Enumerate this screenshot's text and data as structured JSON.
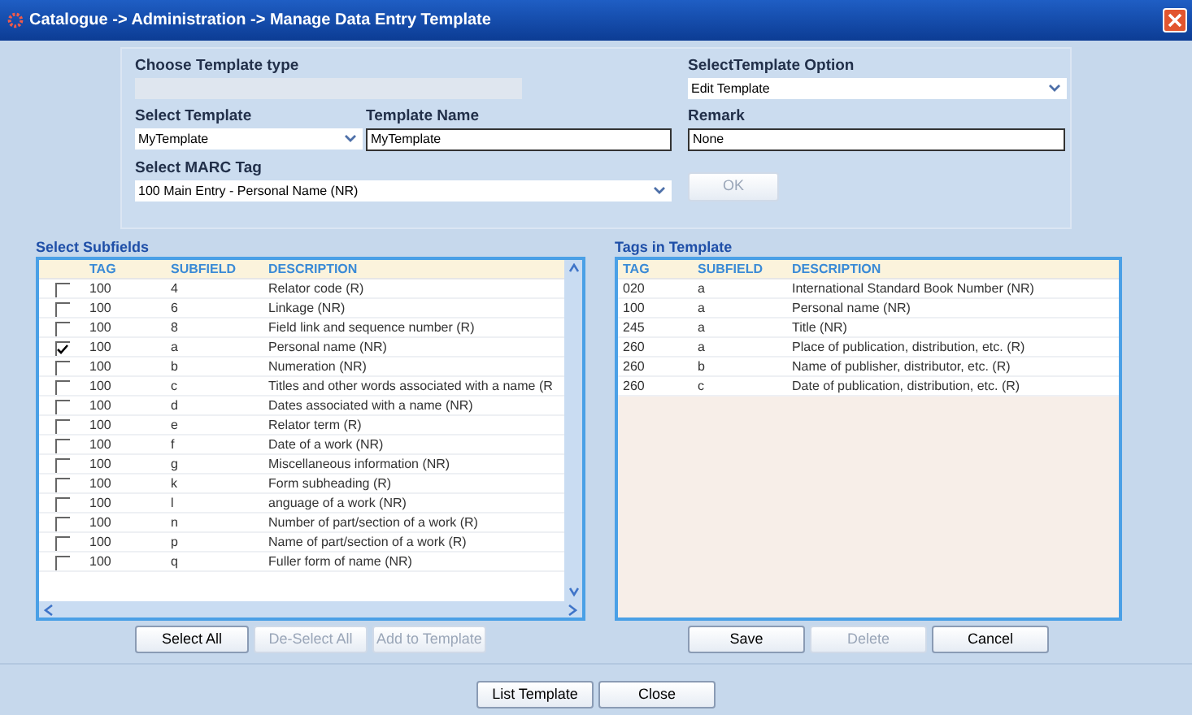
{
  "window": {
    "title": "Catalogue -> Administration -> Manage Data Entry Template"
  },
  "template_type": {
    "label": "Choose Template type",
    "disabled": true
  },
  "template_option": {
    "label": "SelectTemplate Option",
    "value": "Edit Template"
  },
  "select_template": {
    "label": "Select Template",
    "value": "MyTemplate"
  },
  "template_name": {
    "label": "Template Name",
    "value": "MyTemplate"
  },
  "remark": {
    "label": "Remark",
    "value": "None"
  },
  "marc_tag": {
    "label": "Select MARC Tag",
    "value": "100  Main Entry - Personal Name (NR)"
  },
  "ok_button": {
    "label": "OK",
    "disabled": true
  },
  "subfields": {
    "title": "Select Subfields",
    "columns": [
      "TAG",
      "SUBFIELD",
      "DESCRIPTION"
    ],
    "rows": [
      {
        "checked": false,
        "tag": "100",
        "subfield": "4",
        "description": "Relator code (R)"
      },
      {
        "checked": false,
        "tag": "100",
        "subfield": "6",
        "description": "Linkage (NR)"
      },
      {
        "checked": false,
        "tag": "100",
        "subfield": "8",
        "description": "Field link  and sequence number (R)"
      },
      {
        "checked": true,
        "tag": "100",
        "subfield": "a",
        "description": "Personal name (NR)"
      },
      {
        "checked": false,
        "tag": "100",
        "subfield": "b",
        "description": "Numeration (NR)"
      },
      {
        "checked": false,
        "tag": "100",
        "subfield": "c",
        "description": "Titles and other words  associated with a name (R"
      },
      {
        "checked": false,
        "tag": "100",
        "subfield": "d",
        "description": "Dates associated with a name (NR)"
      },
      {
        "checked": false,
        "tag": "100",
        "subfield": "e",
        "description": "Relator term (R)"
      },
      {
        "checked": false,
        "tag": "100",
        "subfield": "f",
        "description": "Date of a work (NR)"
      },
      {
        "checked": false,
        "tag": "100",
        "subfield": "g",
        "description": "Miscellaneous  information  (NR)"
      },
      {
        "checked": false,
        "tag": "100",
        "subfield": "k",
        "description": "Form subheading (R)"
      },
      {
        "checked": false,
        "tag": "100",
        "subfield": "l",
        "description": "anguage of a work (NR)"
      },
      {
        "checked": false,
        "tag": "100",
        "subfield": "n",
        "description": "Number of part/section of a work (R)"
      },
      {
        "checked": false,
        "tag": "100",
        "subfield": "p",
        "description": "Name of part/section of a work (R)"
      },
      {
        "checked": false,
        "tag": "100",
        "subfield": "q",
        "description": "Fuller form of name (NR)"
      }
    ],
    "buttons": [
      {
        "label": "Select All",
        "disabled": false
      },
      {
        "label": "De-Select All",
        "disabled": true
      },
      {
        "label": "Add to Template",
        "disabled": true
      }
    ]
  },
  "tags_in_template": {
    "title": "Tags in Template",
    "columns": [
      "TAG",
      "SUBFIELD",
      "DESCRIPTION"
    ],
    "rows": [
      {
        "tag": "020",
        "subfield": "a",
        "description": "International Standard  Book  Number (NR)"
      },
      {
        "tag": "100",
        "subfield": "a",
        "description": "Personal name (NR)"
      },
      {
        "tag": "245",
        "subfield": "a",
        "description": "Title (NR)"
      },
      {
        "tag": "260",
        "subfield": "a",
        "description": "Place of publication,  distribution,  etc.  (R)"
      },
      {
        "tag": "260",
        "subfield": "b",
        "description": "Name of publisher, distributor, etc.  (R)"
      },
      {
        "tag": "260",
        "subfield": "c",
        "description": "Date of publication, distribution, etc.  (R)"
      }
    ],
    "buttons": [
      {
        "label": "Save",
        "disabled": false
      },
      {
        "label": "Delete",
        "disabled": true
      },
      {
        "label": "Cancel",
        "disabled": false
      }
    ]
  },
  "footer_buttons": [
    {
      "label": "List Template",
      "disabled": false
    },
    {
      "label": "Close",
      "disabled": false
    }
  ]
}
